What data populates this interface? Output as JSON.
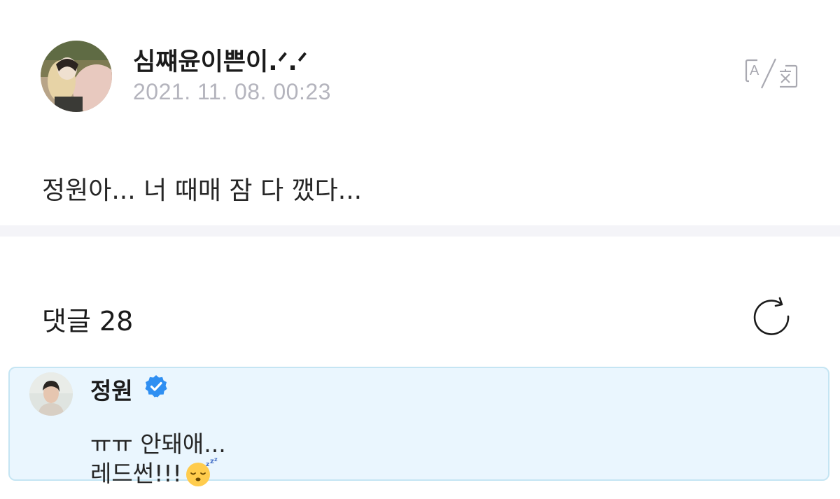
{
  "post": {
    "author_name": "심쨰윤이쁜이.ᐟ.ᐟ",
    "timestamp": "2021. 11. 08. 00:23",
    "body": "정원아... 너 때매 잠 다 깼다...",
    "translate_icon": "translate-icon"
  },
  "comments": {
    "title": "댓글 28",
    "refresh_icon": "refresh-icon",
    "highlighted": {
      "author": "정원",
      "verified_icon": "verified-badge-icon",
      "line1": "ㅠㅠ 안돼애...",
      "line2": "레드썬!!!",
      "emoji": "sleeping-face-emoji"
    }
  },
  "colors": {
    "timestamp": "#b4b4bd",
    "divider": "#f4f4f8",
    "highlight_bg": "#eaf6fe",
    "highlight_border": "#c5e5f3",
    "verified": "#2f8ff2"
  }
}
